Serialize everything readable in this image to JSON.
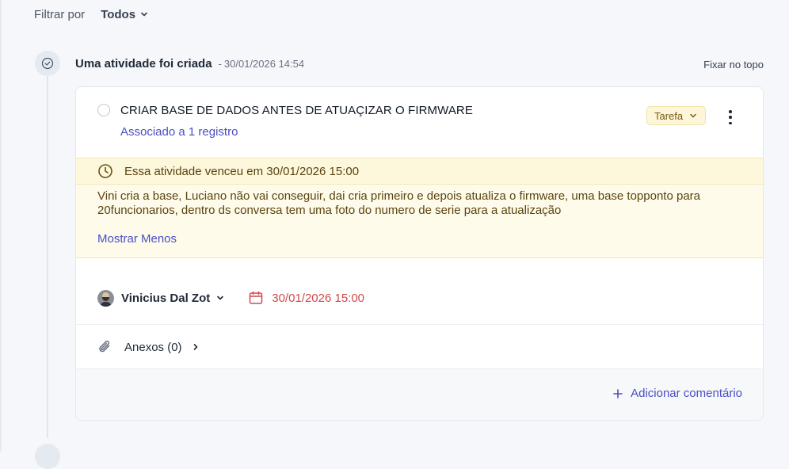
{
  "filter": {
    "label": "Filtrar por",
    "value": "Todos"
  },
  "event": {
    "title": "Uma atividade foi criada",
    "separator": "-",
    "timestamp": "30/01/2026 14:54",
    "pin_label": "Fixar no topo"
  },
  "task": {
    "title": "CRIAR BASE DE DADOS ANTES DE ATUAÇIZAR O FIRMWARE",
    "association": "Associado a 1 registro",
    "type_badge": "Tarefa",
    "overdue_text": "Essa atividade venceu em 30/01/2026 15:00",
    "description": "Vini cria a base, Luciano não vai conseguir, dai cria primeiro e depois atualiza o firmware, uma base topponto para 20funcionarios, dentro ds conversa tem uma foto do numero de serie para a atualização",
    "show_less": "Mostrar Menos",
    "assignee": "Vinicius Dal Zot",
    "due_date": "30/01/2026 15:00",
    "attachments_label": "Anexos (0)",
    "add_comment": "Adicionar comentário"
  },
  "icons": {
    "filter_chevron": "chevron-down-icon",
    "timeline": "check-circle-icon",
    "badge_chevron": "chevron-down-icon",
    "menu": "kebab-menu-icon",
    "overdue": "clock-icon",
    "assignee_chevron": "chevron-down-icon",
    "due": "calendar-icon",
    "attach": "paperclip-icon",
    "attach_arrow": "chevron-right-icon",
    "comment": "plus-icon"
  },
  "colors": {
    "accent": "#4a4ec4",
    "overdue_bg": "#fdf7dc",
    "due_red": "#d04a4a",
    "badge_bg": "#fdf6d8"
  }
}
